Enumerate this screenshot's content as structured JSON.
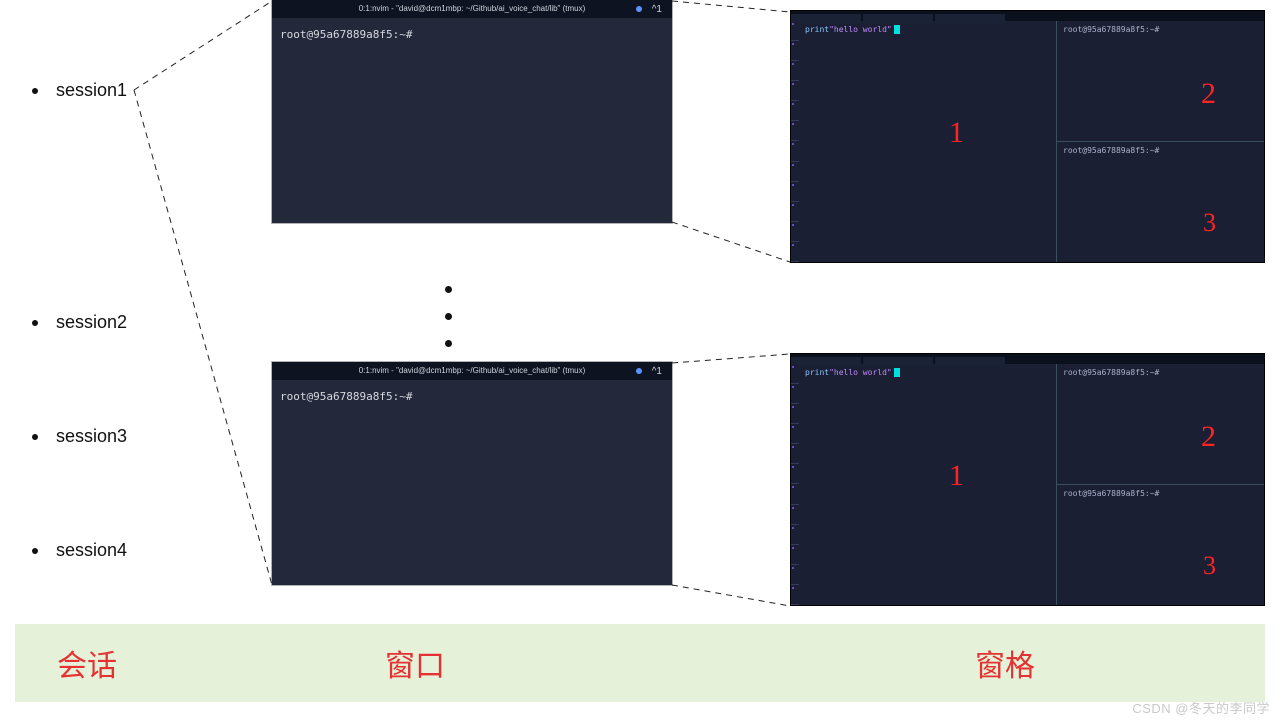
{
  "sessions": [
    "session1",
    "session2",
    "session3",
    "session4"
  ],
  "terminal": {
    "title": "0:1:nvim - \"david@dcm1mbp: ~/Github/ai_voice_chat/lib\" (tmux)",
    "title_suffix": "^1",
    "prompt": "root@95a67889a8f5:~#"
  },
  "panes": {
    "left_code_kw": "print",
    "left_code_str": "\"hello world\"",
    "right_prompt": "root@95a67889a8f5:~#",
    "num1": "1",
    "num2": "2",
    "num3": "3"
  },
  "footer": {
    "session": "会话",
    "window": "窗口",
    "pane": "窗格"
  },
  "watermark": "CSDN @冬天的李同学"
}
